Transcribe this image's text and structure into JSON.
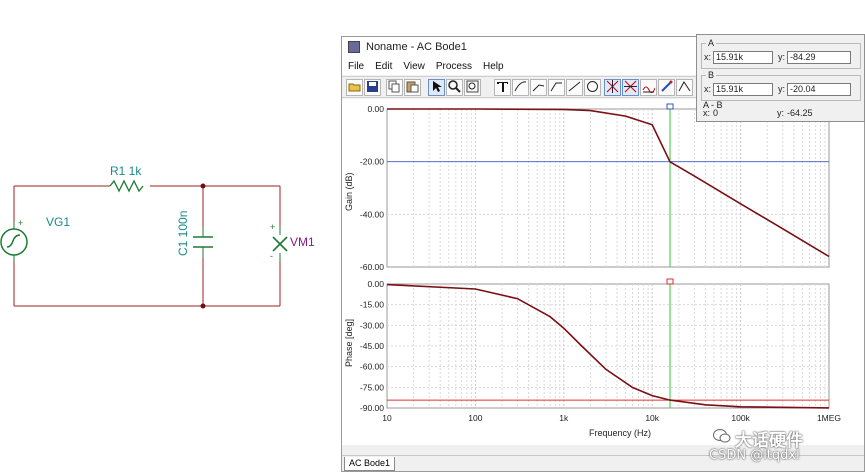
{
  "schematic": {
    "source_label": "VG1",
    "resistor_label": "R1 1k",
    "capacitor_label": "C1 100n",
    "meter_label": "VM1",
    "plus": "+",
    "minus": "-"
  },
  "window": {
    "title": "Noname - AC Bode1",
    "menu": [
      "File",
      "Edit",
      "View",
      "Process",
      "Help"
    ],
    "toolbar_icons": [
      "open-icon",
      "save-icon",
      "copy-icon",
      "paste-icon",
      "pointer-icon",
      "zoom-icon",
      "zoom-fit-icon",
      "text-icon",
      "curve-tool-icon",
      "line-tool-icon",
      "ellipse-tool-icon",
      "cursor-a-icon",
      "cursor-b-icon",
      "marker-icon",
      "pencil-icon",
      "step-icon"
    ],
    "tab_label": "AC Bode1"
  },
  "cursors": {
    "a": {
      "label": "A",
      "x_prefix": "x:",
      "x": "15.91k",
      "y_prefix": "y:",
      "y": "-84.29"
    },
    "b": {
      "label": "B",
      "x_prefix": "x:",
      "x": "15.91k",
      "y_prefix": "y:",
      "y": "-20.04"
    },
    "diff": {
      "label": "A - B",
      "x_prefix": "x:",
      "x": "0",
      "y_prefix": "y:",
      "y": "-64.25"
    }
  },
  "chart_data": [
    {
      "type": "line",
      "ylabel": "Gain (dB)",
      "xscale": "log",
      "xlim": [
        10,
        1000000
      ],
      "ylim": [
        -60,
        0
      ],
      "yticks": [
        "0.00",
        "-20.00",
        "-40.00",
        "-60.00"
      ],
      "series": [
        {
          "x": [
            10,
            100,
            1000,
            2000,
            5000,
            10000,
            15910,
            30000,
            100000,
            300000,
            1000000
          ],
          "y": [
            0.0,
            -0.002,
            -0.17,
            -0.6,
            -2.7,
            -6.0,
            -20.04,
            -25.5,
            -36.0,
            -45.5,
            -56.0
          ]
        }
      ],
      "hline": -20.0,
      "cursor_x": 15910,
      "color": "#7a0f14"
    },
    {
      "type": "line",
      "ylabel": "Phase [deg]",
      "xlabel": "Frequency (Hz)",
      "xscale": "log",
      "xlim": [
        10,
        1000000
      ],
      "ylim": [
        -90,
        0
      ],
      "yticks": [
        "0.00",
        "-15.00",
        "-30.00",
        "-45.00",
        "-60.00",
        "-75.00",
        "-90.00"
      ],
      "xticks": [
        "10",
        "100",
        "1k",
        "10k",
        "100k",
        "1MEG"
      ],
      "series": [
        {
          "x": [
            10,
            100,
            300,
            700,
            1000,
            1592,
            3000,
            6000,
            10000,
            15910,
            40000,
            100000,
            1000000
          ],
          "y": [
            -0.4,
            -3.6,
            -10.7,
            -23.7,
            -32.1,
            -45.0,
            -62.0,
            -75.1,
            -81.0,
            -84.29,
            -87.7,
            -89.1,
            -89.9
          ]
        }
      ],
      "hline": -84.29,
      "cursor_x": 15910,
      "color": "#7a0f14"
    }
  ],
  "watermark": {
    "line1": "大话硬件",
    "line2": "CSDN @ltqdxl"
  }
}
